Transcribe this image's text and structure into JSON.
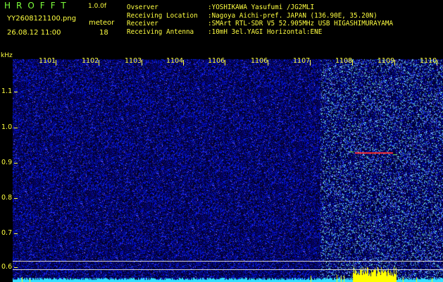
{
  "app": {
    "title": "HROFFT",
    "version": "1.0.0f",
    "file_name": "YY2608121100.png",
    "date_time": "26.08.12 11:00",
    "mode_label": "meteor",
    "count": "18"
  },
  "info": [
    {
      "key": "Ovserver",
      "value": ":YOSHIKAWA Yasufumi /JG2MLI"
    },
    {
      "key": "Receiving Location",
      "value": ":Nagoya Aichi-pref. JAPAN (136.90E, 35.20N)"
    },
    {
      "key": "Receiver",
      "value": ":SMArt RTL-SDR V5 52.905MHz USB HIGASHIMURAYAMA"
    },
    {
      "key": "Receiving Antenna",
      "value": ":10mH 3el.YAGI Horizontal:ENE"
    }
  ],
  "axis": {
    "unit": "kHz",
    "y_ticks": [
      "1.1",
      "1.0",
      "0.9",
      "0.8",
      "0.7",
      "0.6"
    ],
    "x_ticks": [
      "1101",
      "1102",
      "1103",
      "1104",
      "1106",
      "1106",
      "1107",
      "1108",
      "1109",
      "1110"
    ]
  },
  "colors": {
    "label": "#ffff40",
    "title": "#7cff3a",
    "noise": "#1a2cff",
    "baseline": "#d8d8d8",
    "meteor": "#ff3030",
    "level": "#33e0ff",
    "burst": "#ffff00"
  }
}
